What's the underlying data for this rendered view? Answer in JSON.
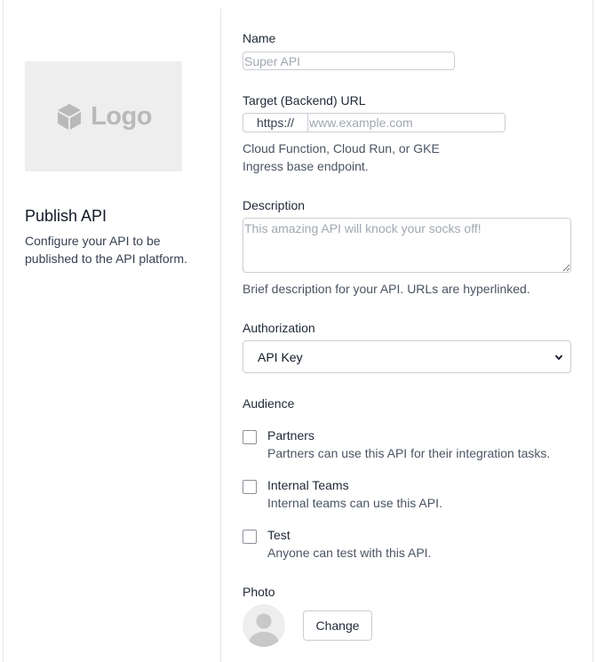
{
  "sidebar": {
    "logo_text": "Logo",
    "logo_icon": "cube-icon",
    "title": "Publish API",
    "description": "Configure your API to be published to the API platform."
  },
  "form": {
    "name": {
      "label": "Name",
      "placeholder": "Super API",
      "value": ""
    },
    "target_url": {
      "label": "Target (Backend) URL",
      "prefix": "https://",
      "placeholder": "www.example.com",
      "value": "",
      "help": "Cloud Function, Cloud Run, or GKE Ingress base endpoint."
    },
    "description": {
      "label": "Description",
      "placeholder": "This amazing API will knock your socks off!",
      "value": "",
      "help": "Brief description for your API. URLs are hyperlinked."
    },
    "authorization": {
      "label": "Authorization",
      "selected": "API Key"
    },
    "audience": {
      "label": "Audience",
      "options": [
        {
          "title": "Partners",
          "description": "Partners can use this API for their integration tasks.",
          "checked": false
        },
        {
          "title": "Internal Teams",
          "description": "Internal teams can use this API.",
          "checked": false
        },
        {
          "title": "Test",
          "description": "Anyone can test with this API.",
          "checked": false
        }
      ]
    },
    "photo": {
      "label": "Photo",
      "change_label": "Change",
      "avatar_icon": "user-avatar-icon"
    }
  },
  "colors": {
    "border": "#c9cdd3",
    "placeholder": "#a1a7b0",
    "logo_bg": "#eeeeee",
    "logo_fg": "#b9b9b9",
    "divider": "#e5e7eb"
  }
}
